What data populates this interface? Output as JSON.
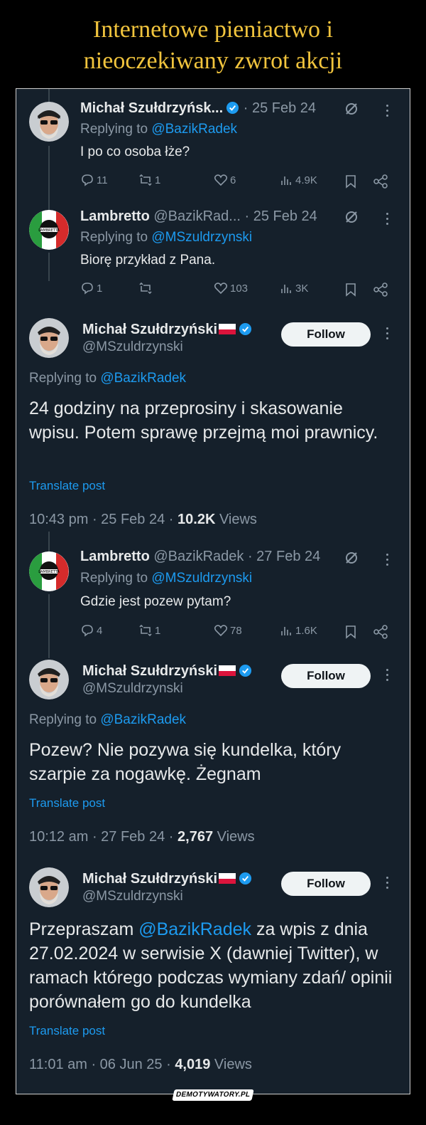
{
  "page_title": {
    "line1": "Internetowe pieniactwo i",
    "line2": "nieoczekiwany zwrot akcji"
  },
  "colors": {
    "accent": "#1d9bf0",
    "background": "#15202b",
    "title": "#f1c43d",
    "muted": "#8b98a5"
  },
  "tweets": [
    {
      "name": "Michał Szułdrzyńsk...",
      "date": "· 25 Feb 24",
      "replying_prefix": "Replying to",
      "replying_handle": "@BazikRadek",
      "text": "I po co osoba łże?",
      "replies": "11",
      "reposts": "1",
      "likes": "6",
      "views": "4.9K"
    },
    {
      "name": "Lambretto",
      "handle": "@BazikRad...",
      "date": "· 25 Feb 24",
      "replying_prefix": "Replying to",
      "replying_handle": "@MSzuldrzynski",
      "text": "Biorę przykład z Pana.",
      "replies": "1",
      "reposts": "",
      "likes": "103",
      "views": "3K"
    },
    {
      "name": "Michał Szułdrzyński",
      "handle": "@MSzuldrzynski",
      "follow_label": "Follow",
      "replying_prefix": "Replying to",
      "replying_handle": "@BazikRadek",
      "text": "24 godziny na przeprosiny i skasowanie wpisu. Potem sprawę przejmą moi prawnicy.",
      "translate": "Translate post",
      "time": "10:43 pm · 25 Feb 24 · ",
      "views_count": "10.2K",
      "views_label": " Views"
    },
    {
      "name": "Lambretto",
      "handle": "@BazikRadek",
      "date": "· 27 Feb 24",
      "replying_prefix": "Replying to",
      "replying_handle": "@MSzuldrzynski",
      "text": "Gdzie jest pozew pytam?",
      "replies": "4",
      "reposts": "1",
      "likes": "78",
      "views": "1.6K"
    },
    {
      "name": "Michał Szułdrzyński",
      "handle": "@MSzuldrzynski",
      "follow_label": "Follow",
      "replying_prefix": "Replying to",
      "replying_handle": "@BazikRadek",
      "text": "Pozew? Nie pozywa się kundelka, który szarpie za nogawkę. Żegnam",
      "translate": "Translate post",
      "time": "10:12 am · 27 Feb 24 · ",
      "views_count": "2,767",
      "views_label": " Views"
    },
    {
      "name": "Michał Szułdrzyński",
      "handle": "@MSzuldrzynski",
      "follow_label": "Follow",
      "text_before": "Przepraszam ",
      "text_mention": "@BazikRadek",
      "text_after": " za wpis z dnia 27.02.2024 w serwisie X (dawniej Twitter), w ramach którego podczas wymiany zdań/ opinii porównałem go do kundelka",
      "translate": "Translate post",
      "time": "11:01 am · 06 Jun 25 · ",
      "views_count": "4,019",
      "views_label": " Views"
    }
  ],
  "watermark": "DEMOTYWATORY.PL"
}
